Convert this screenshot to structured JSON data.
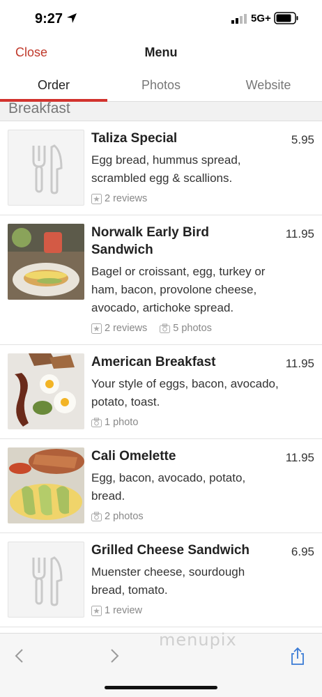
{
  "status_bar": {
    "time": "9:27",
    "network": "5G+"
  },
  "header": {
    "close_label": "Close",
    "title": "Menu"
  },
  "tabs": [
    {
      "label": "Order",
      "active": true
    },
    {
      "label": "Photos",
      "active": false
    },
    {
      "label": "Website",
      "active": false
    }
  ],
  "section": {
    "title": "Breakfast"
  },
  "items": [
    {
      "name": "Taliza Special",
      "price": "5.95",
      "desc": "Egg bread, hummus spread, scrambled egg & scallions.",
      "reviews": "2 reviews",
      "photos": ""
    },
    {
      "name": "Norwalk Early Bird Sandwich",
      "price": "11.95",
      "desc": "Bagel or croissant, egg, turkey or ham, bacon, provolone cheese, avocado, artichoke spread.",
      "reviews": "2 reviews",
      "photos": "5 photos"
    },
    {
      "name": "American Breakfast",
      "price": "11.95",
      "desc": "Your style of eggs, bacon, avocado, potato, toast.",
      "reviews": "",
      "photos": "1 photo"
    },
    {
      "name": "Cali Omelette",
      "price": "11.95",
      "desc": "Egg, bacon, avocado, potato, bread.",
      "reviews": "",
      "photos": "2 photos"
    },
    {
      "name": "Grilled Cheese Sandwich",
      "price": "6.95",
      "desc": "Muenster cheese, sourdough bread, tomato.",
      "reviews": "1 review",
      "photos": ""
    }
  ],
  "watermark": "menupix",
  "colors": {
    "accent": "#d2322d",
    "close": "#c0392b"
  }
}
